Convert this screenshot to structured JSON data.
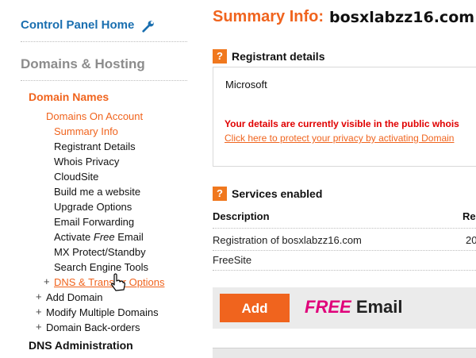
{
  "sidebar": {
    "control_panel_home": "Control Panel Home",
    "domains_hosting": "Domains & Hosting",
    "domain_names": "Domain Names",
    "domains_on_account": "Domains On Account",
    "sub_items": [
      "Summary Info",
      "Registrant Details",
      "Whois Privacy",
      "CloudSite",
      "Build me a website",
      "Upgrade Options",
      "Email Forwarding",
      "Activate",
      "MX Protect/Standby",
      "Search Engine Tools",
      "DNS & Transfer Options"
    ],
    "activate_free_word": "Free",
    "activate_email_word": "Email",
    "expanders": [
      "Add Domain",
      "Modify Multiple Domains",
      "Domain Back-orders"
    ],
    "dns_administration": "DNS Administration"
  },
  "main": {
    "summary_label": "Summary Info:",
    "domain": "bosxlabzz16.com",
    "registrant_title": "Registrant details",
    "registrant_name": "Microsoft",
    "visibility_warning": "Your details are currently visible in the public whois",
    "privacy_link": "Click here to protect your privacy by activating Domain",
    "services_title": "Services enabled",
    "columns": [
      "Description",
      "Re"
    ],
    "rows": [
      {
        "description": "Registration of bosxlabzz16.com",
        "value": "20"
      },
      {
        "description": "FreeSite",
        "value": ""
      }
    ],
    "add_button": "Add",
    "promo_free": "FREE",
    "promo_email": "Email"
  },
  "colors": {
    "accent": "#f0641e",
    "link_blue": "#1a6fb0",
    "warning_red": "#e00000",
    "promo_pink": "#e0007a"
  },
  "icons": {
    "wrench": "wrench-icon",
    "help": "question-icon",
    "cursor": "hand-pointer-icon",
    "expand": "plus-icon"
  }
}
